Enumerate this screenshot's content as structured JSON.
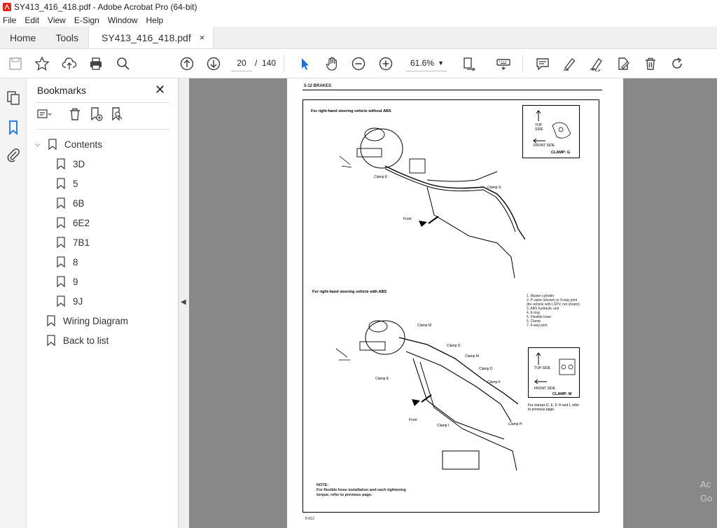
{
  "window": {
    "title": "SY413_416_418.pdf - Adobe Acrobat Pro (64-bit)"
  },
  "menu": [
    "File",
    "Edit",
    "View",
    "E-Sign",
    "Window",
    "Help"
  ],
  "tabs": {
    "home": "Home",
    "tools": "Tools",
    "document": "SY413_416_418.pdf",
    "close": "×"
  },
  "toolbar": {
    "page_current": "20",
    "page_sep": "/",
    "page_total": "140",
    "zoom": "61.6%"
  },
  "bookmarks": {
    "title": "Bookmarks",
    "close": "✕",
    "items": [
      {
        "label": "Contents",
        "level": 0,
        "expanded": true
      },
      {
        "label": "3D",
        "level": 1
      },
      {
        "label": "5",
        "level": 1
      },
      {
        "label": "6B",
        "level": 1
      },
      {
        "label": "6E2",
        "level": 1
      },
      {
        "label": "7B1",
        "level": 1
      },
      {
        "label": "8",
        "level": 1
      },
      {
        "label": "9",
        "level": 1
      },
      {
        "label": "9J",
        "level": 1
      },
      {
        "label": "Wiring Diagram",
        "level": 0
      },
      {
        "label": "Back to list",
        "level": 0
      }
    ]
  },
  "document": {
    "header": "5-12   BRAKES",
    "section1": "For right-hand steering vehicle without ABS",
    "section2": "For right-hand steering vehicle with ABS",
    "clamp_g": {
      "top": "TOP",
      "side": "SIDE",
      "front": "FRONT SIDE",
      "name": "CLAMP: G"
    },
    "clamp_m": {
      "top": "TOP SIDE",
      "front": "FRONT SIDE",
      "name": "CLAMP: M"
    },
    "clamp_note": "For clamps D, E, F, H and I, refer to previous page.",
    "legend": [
      "1.  Master cylinder",
      "2.  P valve (shown) or 6-way joint",
      "     (for vehicle with LSPV, not shown)",
      "3.  ABS hydraulic unit",
      "4.  E-ring",
      "5.  Flexible hose",
      "6.  Clamp",
      "7.  4-way joint"
    ],
    "labels_top": {
      "clamp_e": "Clamp E",
      "clamp_g": "Clamp G",
      "front": "Front"
    },
    "labels_bottom": {
      "clamp_m1": "Clamp M",
      "clamp_d1": "Clamp D",
      "clamp_m2": "Clamp M",
      "clamp_d2": "Clamp D",
      "clamp_e": "Clamp E",
      "clamp_f": "Clamp F",
      "clamp_i": "Clamp I",
      "clamp_h": "Clamp H",
      "front": "Front"
    },
    "note_title": "NOTE:",
    "note_body": "For flexible hose installation and each tightening torque, refer to previous page.",
    "footer": "5-012"
  },
  "watermark": [
    "Ac",
    "Go"
  ]
}
